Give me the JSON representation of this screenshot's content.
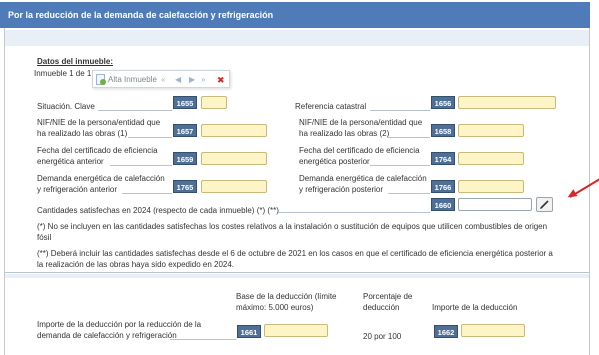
{
  "header": {
    "title": "Por la reducción de la demanda de calefacción y refrigeración"
  },
  "section": {
    "title": "Datos del inmueble:",
    "counter": "Inmueble 1 de 1"
  },
  "popup": {
    "add_label": "Alta Inmueble",
    "first": "«",
    "prev": "◀",
    "next": "▶",
    "last": "»",
    "delete": "✖"
  },
  "fields": {
    "situacion": {
      "label": "Situación. Clave",
      "code": "1655",
      "value": ""
    },
    "referencia": {
      "label": "Referencia catastral",
      "code": "1656",
      "value": ""
    },
    "nif1": {
      "label1": "NIF/NIE de la persona/entidad que",
      "label2": "ha realizado las obras (1)",
      "code": "1657",
      "value": ""
    },
    "nif2": {
      "label1": "NIF/NIE de la persona/entidad que",
      "label2": "ha realizado las obras (2)",
      "code": "1658",
      "value": ""
    },
    "fecha_ant": {
      "label1": "Fecha del certificado de eficiencia",
      "label2": "energética anterior",
      "code": "1659",
      "value": ""
    },
    "fecha_post": {
      "label1": "Fecha del certificado de eficiencia",
      "label2": "energética posterior",
      "code": "1764",
      "value": ""
    },
    "dem_ant": {
      "label1": "Demanda energética de calefacción",
      "label2": "y refrigeración anterior",
      "code": "1765",
      "value": ""
    },
    "dem_post": {
      "label1": "Demanda energética de calefacción",
      "label2": "y refrigeración posterior",
      "code": "1766",
      "value": ""
    },
    "cantidades": {
      "label": "Cantidades satisfechas en 2024 (respecto de cada inmueble) (*) (**)",
      "code": "1660",
      "value": "",
      "edit_icon": "pencil-icon"
    }
  },
  "notes": {
    "n1_line1": "(*) No se incluyen en las cantidades satisfechas los costes relativos a la instalación o sustitución de equipos que utilicen combustibles de origen",
    "n1_line2": "fósil",
    "n2_line1": "(**) Deberá incluir las cantidades satisfechas desde el 6 de octubre de 2021 en los casos en que el certificado de eficiencia energética posterior a",
    "n2_line2": "la realización de las obras haya sido expedido en 2024."
  },
  "deduction": {
    "col_base1": "Base de la deducción (límite",
    "col_base2": "máximo: 5.000 euros)",
    "col_pct1": "Porcentaje de",
    "col_pct2": "deducción",
    "col_importe": "Importe de la deducción",
    "row_label1": "Importe de la deducción por la reducción de la",
    "row_label2": "demanda de calefacción y refrigeración",
    "base_code": "1661",
    "base_value": "",
    "pct_value": "20 por 100",
    "importe_code": "1662",
    "importe_value": ""
  },
  "colors": {
    "header_bg": "#4f7cb8",
    "code_bg": "#4f6f97",
    "field_bg": "#fdf5c6",
    "arrow": "#d8262b"
  }
}
